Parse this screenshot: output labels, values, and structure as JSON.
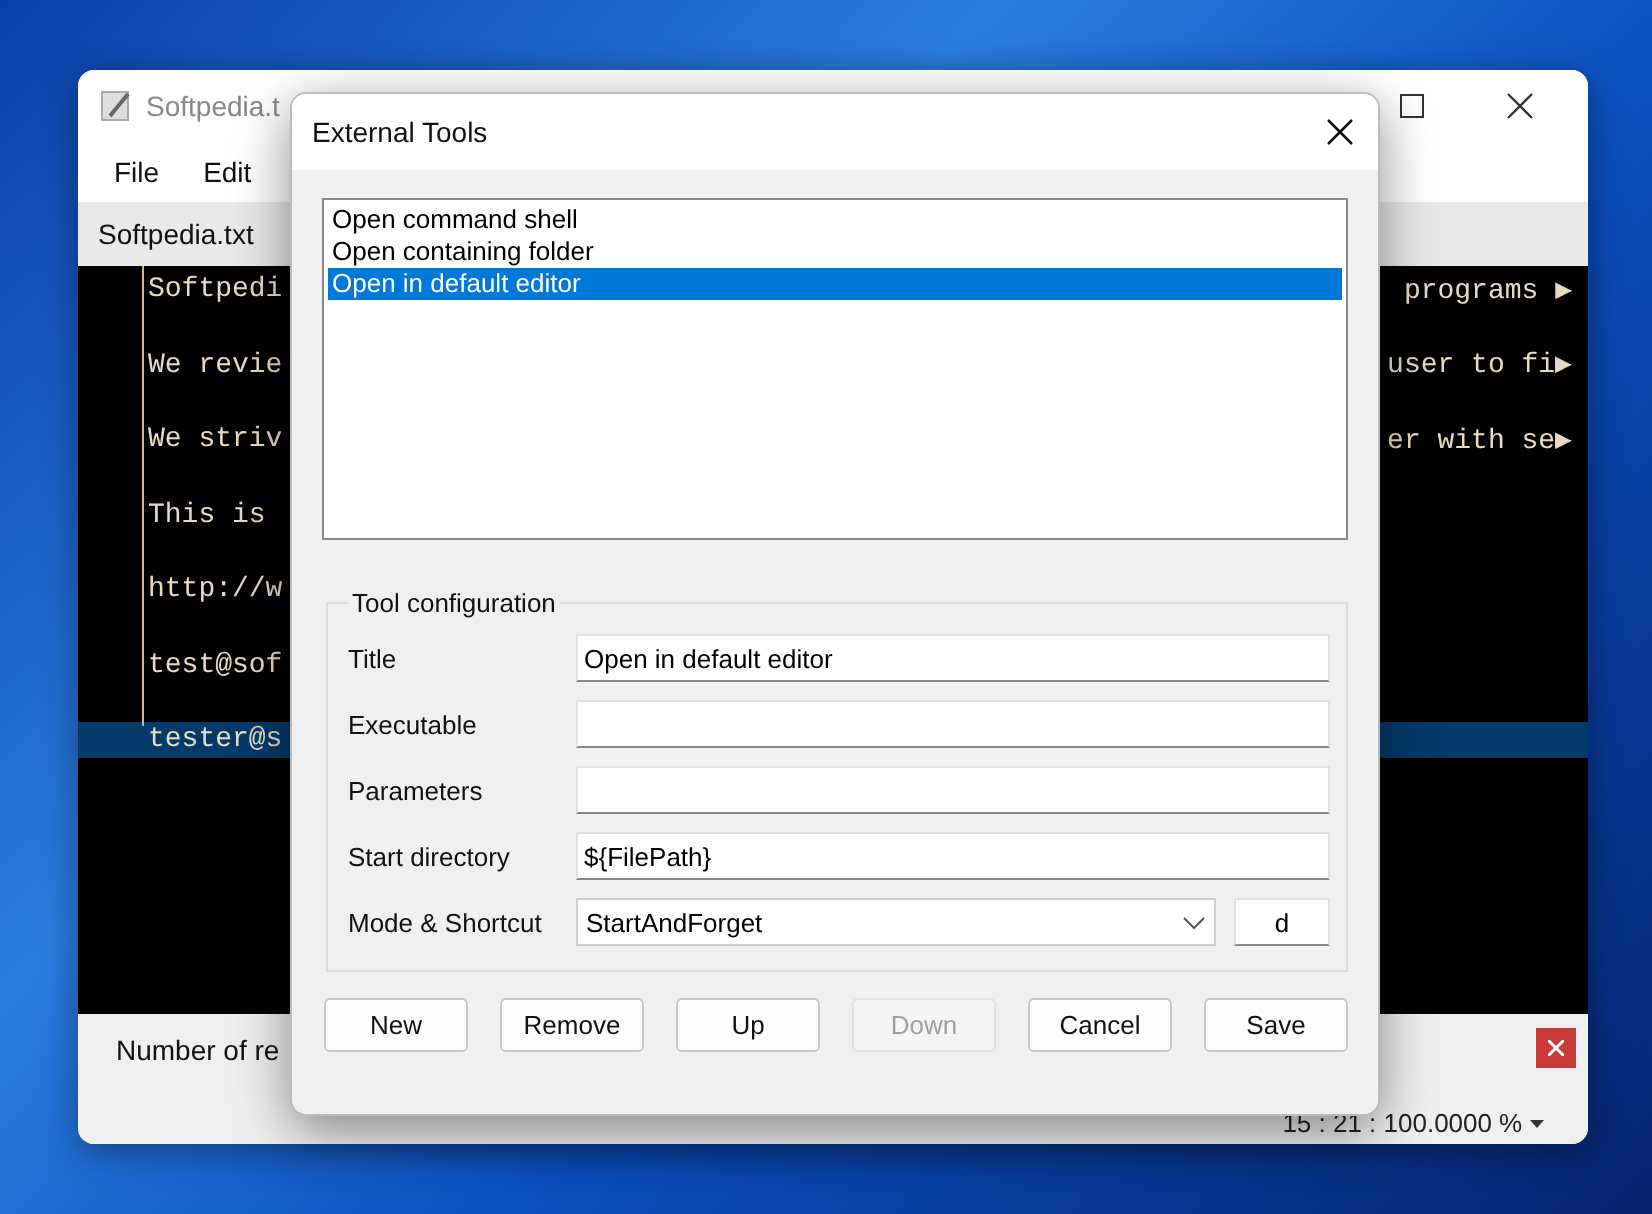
{
  "back_window": {
    "title": "Softpedia.t",
    "menu": [
      "File",
      "Edit"
    ],
    "tab": "Softpedia.txt",
    "lines": [
      {
        "left": "Softpedi",
        "right": "programs ▶",
        "selected": false
      },
      {
        "left": "We revie",
        "right": "user to fi▶",
        "selected": false
      },
      {
        "left": "We striv",
        "right": "er with se▶",
        "selected": false
      },
      {
        "left": "This is",
        "selected": false
      },
      {
        "left": "http://w",
        "selected": false
      },
      {
        "left": "test@sof",
        "selected": false
      },
      {
        "left": "tester@s",
        "selected": true
      }
    ],
    "status": "Number of re",
    "position": "15 : 21 : 100.0000",
    "zoom_unit": "%"
  },
  "dialog": {
    "title": "External Tools",
    "tools": [
      {
        "label": "Open command shell",
        "selected": false
      },
      {
        "label": "Open containing folder",
        "selected": false
      },
      {
        "label": "Open in default editor",
        "selected": true
      }
    ],
    "group": "Tool configuration",
    "fields": [
      {
        "kind": "text",
        "label": "Title",
        "value": "Open in default editor"
      },
      {
        "kind": "text",
        "label": "Executable"
      },
      {
        "kind": "text",
        "label": "Parameters"
      },
      {
        "kind": "text",
        "label": "Start directory",
        "value": "${FilePath}"
      },
      {
        "kind": "combo",
        "label": "Mode & Shortcut",
        "value": "StartAndForget",
        "shortcut": "d"
      }
    ],
    "buttons": [
      {
        "label": "New",
        "disabled": false
      },
      {
        "label": "Remove",
        "disabled": false
      },
      {
        "label": "Up",
        "disabled": false
      },
      {
        "label": "Down",
        "disabled": true
      },
      {
        "label": "Cancel",
        "disabled": false
      },
      {
        "label": "Save",
        "disabled": false
      }
    ]
  }
}
